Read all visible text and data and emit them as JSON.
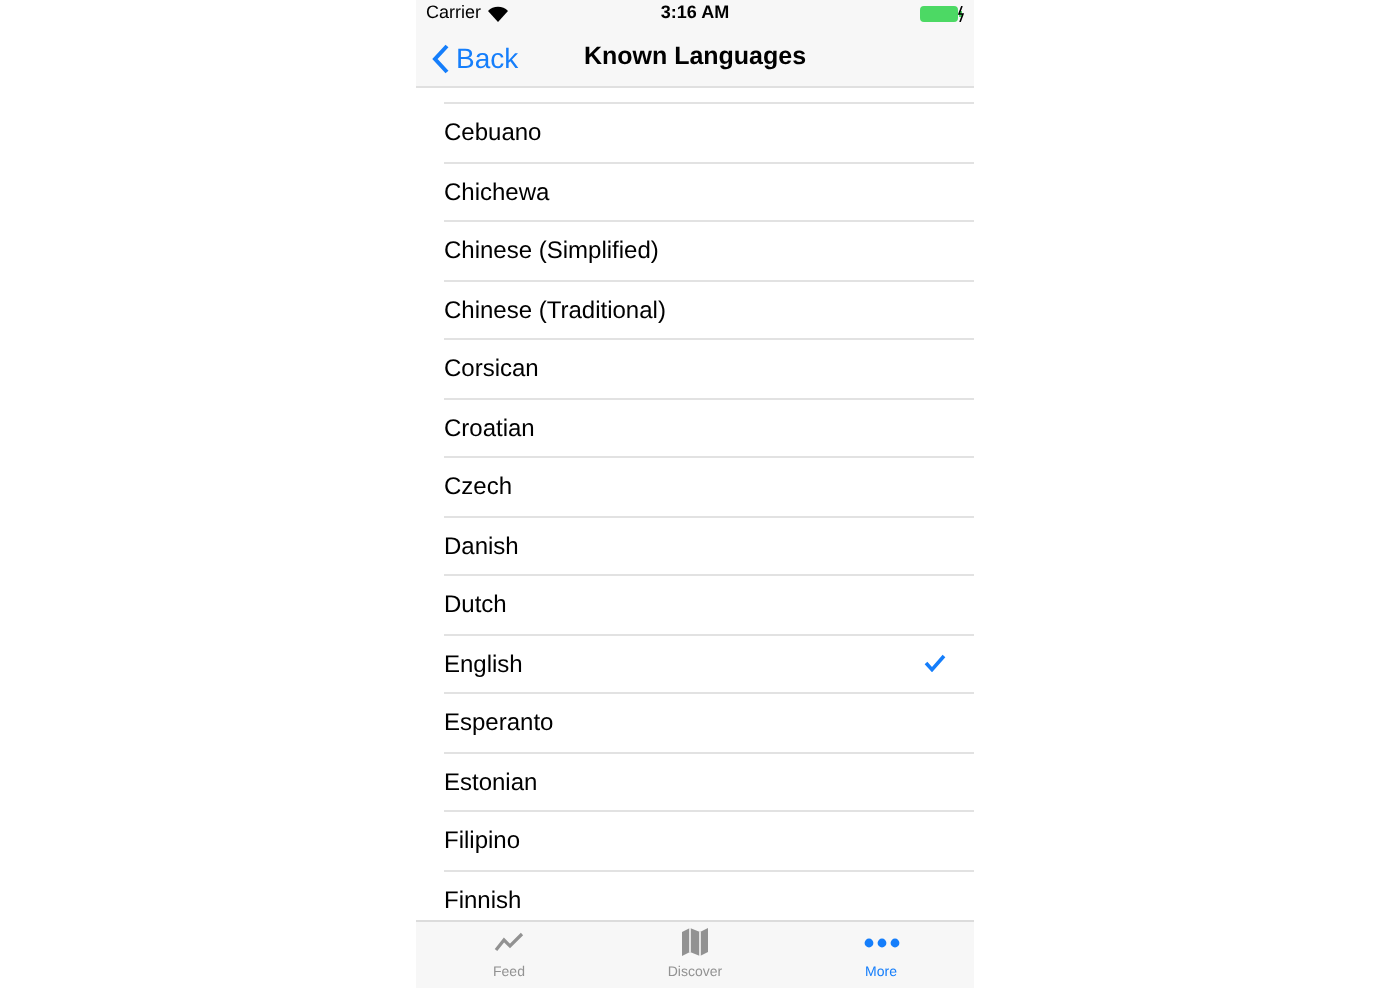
{
  "status_bar": {
    "carrier": "Carrier",
    "time": "3:16 AM"
  },
  "nav": {
    "back": "Back",
    "title": "Known Languages"
  },
  "languages": [
    {
      "name": "Cebuano",
      "selected": false
    },
    {
      "name": "Chichewa",
      "selected": false
    },
    {
      "name": "Chinese (Simplified)",
      "selected": false
    },
    {
      "name": "Chinese (Traditional)",
      "selected": false
    },
    {
      "name": "Corsican",
      "selected": false
    },
    {
      "name": "Croatian",
      "selected": false
    },
    {
      "name": "Czech",
      "selected": false
    },
    {
      "name": "Danish",
      "selected": false
    },
    {
      "name": "Dutch",
      "selected": false
    },
    {
      "name": "English",
      "selected": true
    },
    {
      "name": "Esperanto",
      "selected": false
    },
    {
      "name": "Estonian",
      "selected": false
    },
    {
      "name": "Filipino",
      "selected": false
    },
    {
      "name": "Finnish",
      "selected": false
    }
  ],
  "tabs": [
    {
      "label": "Feed",
      "kind": "feed",
      "selected": false
    },
    {
      "label": "Discover",
      "kind": "discover",
      "selected": false
    },
    {
      "label": "More",
      "kind": "more",
      "selected": true
    }
  ]
}
